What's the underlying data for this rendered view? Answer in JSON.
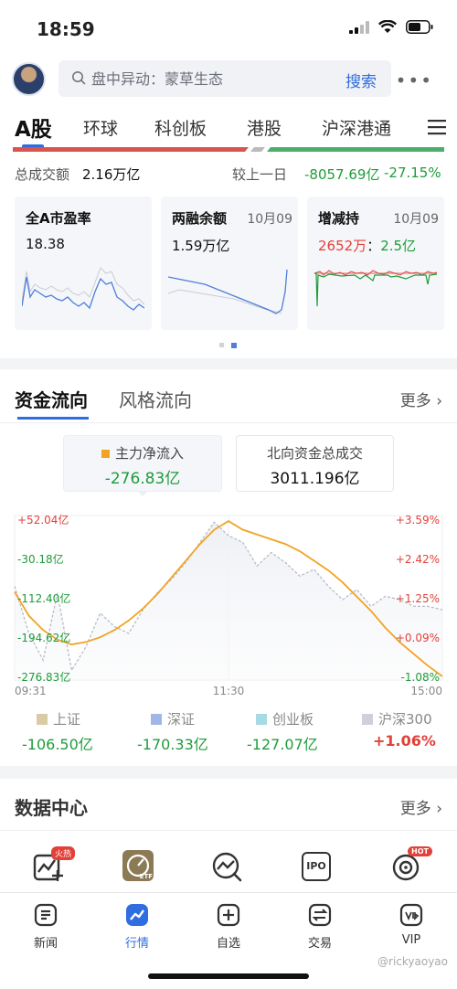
{
  "status": {
    "time": "18:59"
  },
  "search": {
    "placeholder": "盘中异动：蒙草生态",
    "button": "搜索",
    "more": "•••"
  },
  "market_tabs": [
    "A股",
    "环球",
    "科创板",
    "港股",
    "沪深港通"
  ],
  "turnover": {
    "label": "总成交额",
    "value": "2.16万亿",
    "compare_label": "较上一日",
    "change": "-8057.69亿",
    "change_pct": "-27.15%"
  },
  "cards": [
    {
      "title": "全A市盈率",
      "date": "",
      "value": "18.38"
    },
    {
      "title": "两融余额",
      "date": "10月09",
      "value": "1.59万亿"
    },
    {
      "title": "增减持",
      "date": "10月09",
      "value_red": "2652万",
      "value_sep": "：",
      "value_green": "2.5亿"
    }
  ],
  "flow": {
    "tabs": [
      "资金流向",
      "风格流向"
    ],
    "more": "更多",
    "main_box": {
      "label": "主力净流入",
      "value": "-276.83亿"
    },
    "north_box": {
      "label": "北向资金总成交",
      "value": "3011.196亿"
    },
    "legend": [
      {
        "label": "上证",
        "value": "-106.50亿",
        "color": "#d9cba6"
      },
      {
        "label": "深证",
        "value": "-170.33亿",
        "color": "#9fb6e6"
      },
      {
        "label": "创业板",
        "value": "-127.07亿",
        "color": "#a6dbe6"
      },
      {
        "label": "沪深300",
        "value": "+1.06%",
        "color": "#cfcfe0"
      }
    ]
  },
  "chart_data": {
    "type": "line",
    "left_ticks": [
      "+52.04亿",
      "-30.18亿",
      "-112.40亿",
      "-194.62亿",
      "-276.83亿"
    ],
    "right_ticks": [
      "+3.59%",
      "+2.42%",
      "+1.25%",
      "+0.09%",
      "-1.08%"
    ],
    "x_ticks": [
      "09:31",
      "11:30",
      "15:00"
    ],
    "ylim_left": [
      -276.83,
      52.04
    ],
    "ylim_right": [
      -1.08,
      3.59
    ],
    "series": [
      {
        "name": "主力净流入",
        "axis": "left",
        "color": "#f0a422",
        "x": [
          0,
          8,
          16,
          24,
          32,
          40,
          48,
          56,
          64,
          72,
          80,
          88,
          96,
          104,
          112,
          120,
          128,
          136,
          144,
          152,
          160,
          168,
          176,
          184,
          192,
          200,
          208,
          216,
          224,
          232,
          240
        ],
        "y": [
          -100,
          -150,
          -180,
          -200,
          -210,
          -205,
          -195,
          -180,
          -160,
          -135,
          -105,
          -70,
          -35,
          0,
          30,
          48,
          30,
          20,
          10,
          0,
          -15,
          -35,
          -55,
          -80,
          -110,
          -140,
          -175,
          -205,
          -230,
          -255,
          -276.83
        ]
      },
      {
        "name": "沪深300",
        "axis": "right",
        "color": "#b8bcc8",
        "x": [
          0,
          8,
          16,
          24,
          32,
          40,
          48,
          56,
          64,
          72,
          80,
          88,
          96,
          104,
          112,
          120,
          128,
          136,
          144,
          152,
          160,
          168,
          176,
          184,
          192,
          200,
          208,
          216,
          224,
          232,
          240
        ],
        "y": [
          1.6,
          0.2,
          -0.6,
          1.4,
          -0.9,
          -0.2,
          0.8,
          0.4,
          0.2,
          0.9,
          1.4,
          1.8,
          2.3,
          2.9,
          3.5,
          3.1,
          2.9,
          2.2,
          2.6,
          2.3,
          1.9,
          2.1,
          1.6,
          1.2,
          1.5,
          1.0,
          1.3,
          1.2,
          1.0,
          1.0,
          0.9
        ]
      }
    ]
  },
  "data_center": {
    "title": "数据中心",
    "more": "更多",
    "badges": [
      "火热",
      "HOT"
    ],
    "icons": [
      "ETF",
      "IPO"
    ]
  },
  "bottom_nav": [
    {
      "label": "新闻",
      "icon": "news-icon"
    },
    {
      "label": "行情",
      "icon": "market-icon"
    },
    {
      "label": "自选",
      "icon": "watchlist-icon"
    },
    {
      "label": "交易",
      "icon": "trade-icon"
    },
    {
      "label": "VIP",
      "icon": "vip-icon"
    }
  ],
  "watermark": "@rickyaoyao",
  "colors": {
    "accent": "#2f6de0",
    "up": "#e2413a",
    "down": "#1e9c3b",
    "main_line": "#f0a422"
  }
}
